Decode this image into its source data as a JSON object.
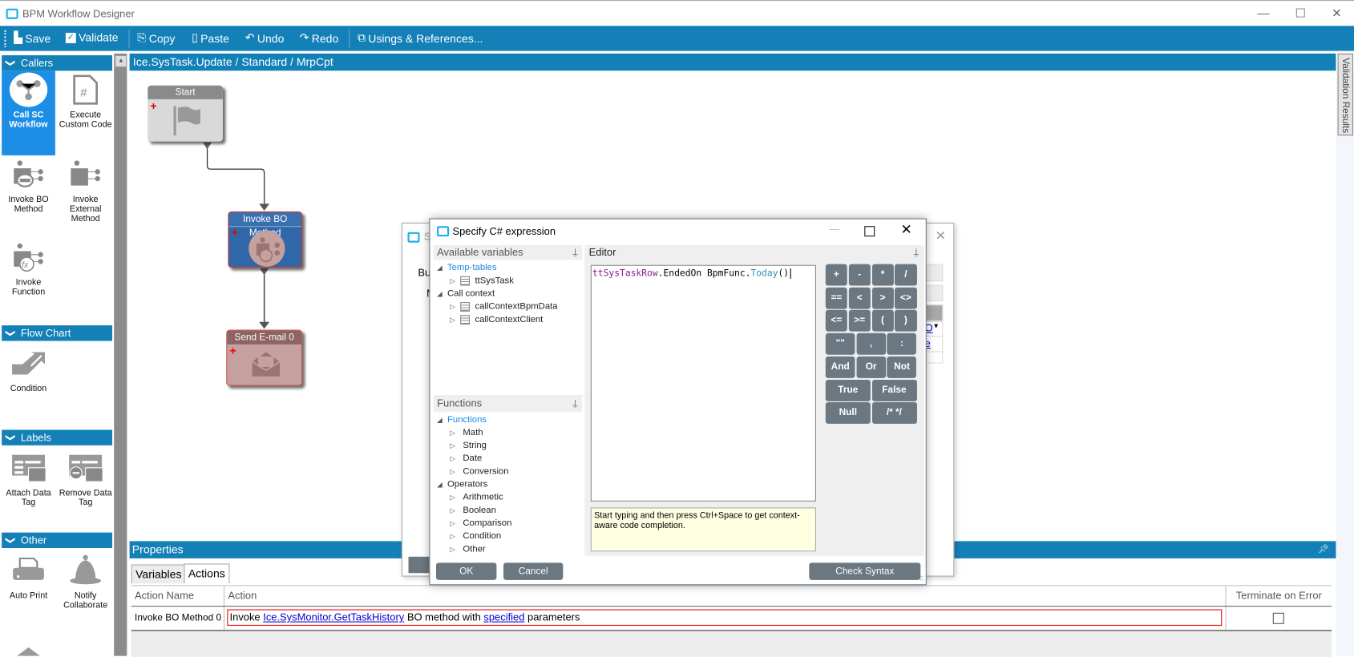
{
  "window": {
    "title": "BPM Workflow Designer",
    "min": "—",
    "max": "☐",
    "close": "✕"
  },
  "toolbar": {
    "save": "Save",
    "validate": "Validate",
    "copy": "Copy",
    "paste": "Paste",
    "undo": "Undo",
    "redo": "Redo",
    "usings": "Usings & References..."
  },
  "breadcrumb": "Ice.SysTask.Update / Standard / MrpCpt",
  "validation_tab": "Validation Results",
  "sidebar": {
    "sections": [
      {
        "title": "Callers",
        "items": [
          {
            "label": "Call SC Workflow",
            "icon": "workflow-icon",
            "selected": true
          },
          {
            "label": "Execute Custom Code",
            "icon": "code-file-icon"
          },
          {
            "label": "Invoke BO Method",
            "icon": "bo-method-icon"
          },
          {
            "label": "Invoke External Method",
            "icon": "external-method-icon"
          },
          {
            "label": "Invoke Function",
            "icon": "function-icon"
          }
        ]
      },
      {
        "title": "Flow Chart",
        "items": [
          {
            "label": "Condition",
            "icon": "condition-icon"
          }
        ]
      },
      {
        "title": "Labels",
        "items": [
          {
            "label": "Attach Data Tag",
            "icon": "attach-tag-icon"
          },
          {
            "label": "Remove Data Tag",
            "icon": "remove-tag-icon"
          }
        ]
      },
      {
        "title": "Other",
        "items": [
          {
            "label": "Auto Print",
            "icon": "printer-icon"
          },
          {
            "label": "Notify Collaborate",
            "icon": "bell-icon"
          }
        ]
      }
    ]
  },
  "canvas": {
    "nodes": [
      {
        "title": "Start",
        "icon": "flag-icon"
      },
      {
        "title": "Invoke BO Method",
        "icon": "bo-method-icon"
      },
      {
        "title": "Send E-mail 0",
        "icon": "envelope-icon"
      }
    ]
  },
  "properties": {
    "title": "Properties",
    "tabs": [
      "Variables",
      "Actions"
    ],
    "active_tab": "Actions",
    "columns": [
      "Action Name",
      "Action",
      "Terminate on Error"
    ],
    "rows": [
      {
        "name": "Invoke BO Method 0",
        "action_prefix": "Invoke",
        "action_link": "Ice.SysMonitor.GetTaskHistory",
        "action_mid": "BO method with",
        "action_link2": "specified",
        "action_suffix": "parameters",
        "terminate": false
      }
    ]
  },
  "bg_dialog": {
    "title_start": "S",
    "label1": "Bu",
    "label2": "M",
    "link1": "O",
    "link2": "e"
  },
  "dialog": {
    "title": "Specify C# expression",
    "vars_header": "Available variables",
    "vars_tree": [
      {
        "label": "Temp-tables",
        "level": 0,
        "expanded": true,
        "blue": true
      },
      {
        "label": "ttSysTask",
        "level": 1,
        "table": true
      },
      {
        "label": "Call context",
        "level": 0,
        "expanded": true
      },
      {
        "label": "callContextBpmData",
        "level": 1,
        "table": true
      },
      {
        "label": "callContextClient",
        "level": 1,
        "table": true
      }
    ],
    "funcs_header": "Functions",
    "funcs_tree": [
      {
        "label": "Functions",
        "level": 0,
        "expanded": true,
        "blue": true
      },
      {
        "label": "Math",
        "level": 1
      },
      {
        "label": "String",
        "level": 1
      },
      {
        "label": "Date",
        "level": 1
      },
      {
        "label": "Conversion",
        "level": 1
      },
      {
        "label": "Operators",
        "level": 0,
        "expanded": true
      },
      {
        "label": "Arithmetic",
        "level": 1
      },
      {
        "label": "Boolean",
        "level": 1
      },
      {
        "label": "Comparison",
        "level": 1
      },
      {
        "label": "Condition",
        "level": 1
      },
      {
        "label": "Other",
        "level": 1
      }
    ],
    "editor_header": "Editor",
    "code": {
      "t1": "ttSysTaskRow",
      "t2": ".EndedOn BpmFunc.",
      "t3": "Today",
      "t4": "()"
    },
    "hint": "Start typing and then press Ctrl+Space to get context-aware code completion.",
    "operators": [
      [
        "+",
        "-",
        "*",
        "/"
      ],
      [
        "==",
        "<",
        ">",
        "<>"
      ],
      [
        "<=",
        ">=",
        "(",
        ")"
      ],
      [
        "\"\"",
        ",",
        ":"
      ],
      [
        "And",
        "Or",
        "Not"
      ],
      [
        "True",
        "False"
      ],
      [
        "Null",
        "/* */"
      ]
    ],
    "ok": "OK",
    "cancel": "Cancel",
    "check_syntax": "Check Syntax"
  },
  "colors": {
    "brand": "#1380b8",
    "button": "#6c7881",
    "code_var": "#8b1c8b",
    "code_func": "#2b91af",
    "link": "#0000cc"
  }
}
